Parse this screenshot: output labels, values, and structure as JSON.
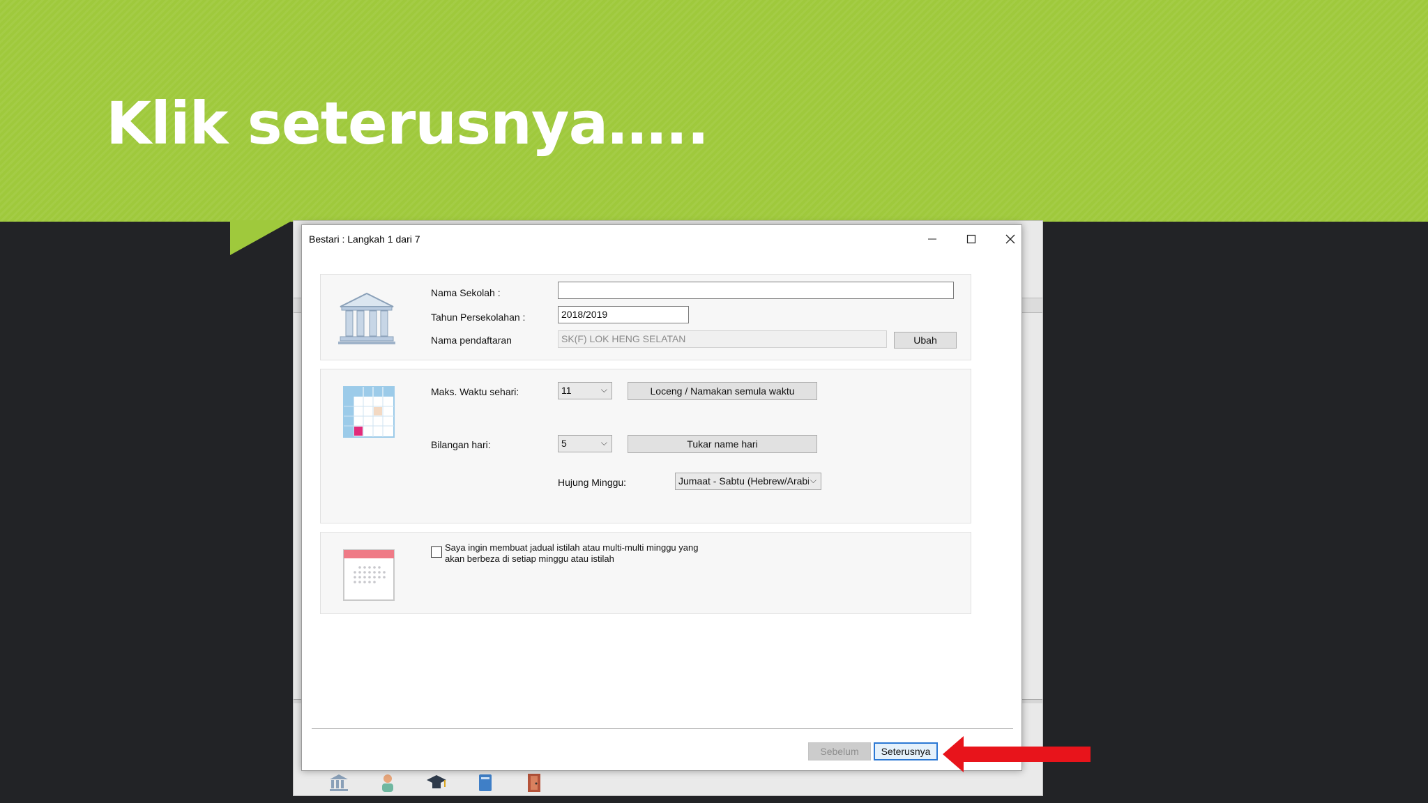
{
  "slide": {
    "title": "Klik seterusnya….."
  },
  "dialog": {
    "title": "Bestari : Langkah 1 dari 7",
    "section1": {
      "nama_sekolah_label": "Nama Sekolah :",
      "nama_sekolah_value": "",
      "tahun_label": "Tahun Persekolahan :",
      "tahun_value": "2018/2019",
      "pendaftaran_label": "Nama pendaftaran",
      "pendaftaran_value": "SK(F) LOK HENG SELATAN",
      "ubah_label": "Ubah"
    },
    "section2": {
      "maks_label": "Maks. Waktu sehari:",
      "maks_value": "11",
      "loceng_label": "Loceng / Namakan semula waktu",
      "bilangan_label": "Bilangan hari:",
      "bilangan_value": "5",
      "tukar_label": "Tukar name hari",
      "hujung_label": "Hujung Minggu:",
      "hujung_value": "Jumaat - Sabtu (Hebrew/Arabi"
    },
    "section3": {
      "checkbox_text_line1": "Saya ingin membuat jadual istilah atau multi-multi minggu yang",
      "checkbox_text_line2": "akan berbeza di setiap minggu atau istilah",
      "checked": false
    },
    "footer": {
      "sebelum_label": "Sebelum",
      "seterusnya_label": "Seterusnya"
    }
  },
  "colors": {
    "banner": "#9fc93c",
    "arrow": "#e8141b",
    "primary_border": "#2b78d4"
  }
}
